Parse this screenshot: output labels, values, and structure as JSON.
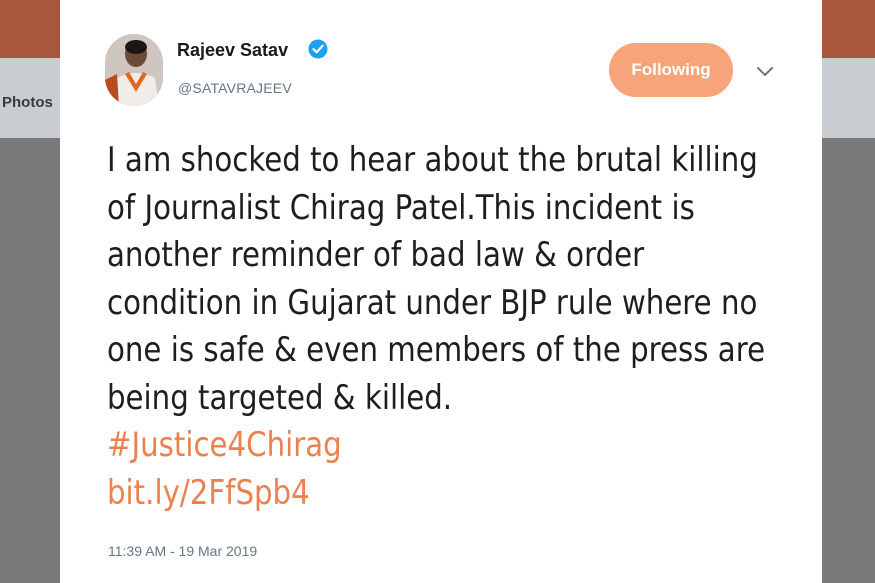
{
  "background": {
    "nav_label": "Photos",
    "top_bar_color": "#a8573a"
  },
  "tweet": {
    "author_name": "Rajeev Satav",
    "author_handle": "@SATAVRAJEEV",
    "verified": true,
    "follow_button_label": "Following",
    "accent_color": "#e9824e",
    "text_lines": [
      "I am shocked to hear about the brutal killing",
      "of Journalist Chirag Patel.This incident is",
      "another reminder of bad law & order",
      "condition in Gujarat under BJP rule where no",
      "one is safe & even members of the press are",
      "being targeted & killed."
    ],
    "hashtag": "#Justice4Chirag",
    "link": "bit.ly/2FfSpb4",
    "timestamp": "11:39 AM - 19 Mar 2019"
  }
}
